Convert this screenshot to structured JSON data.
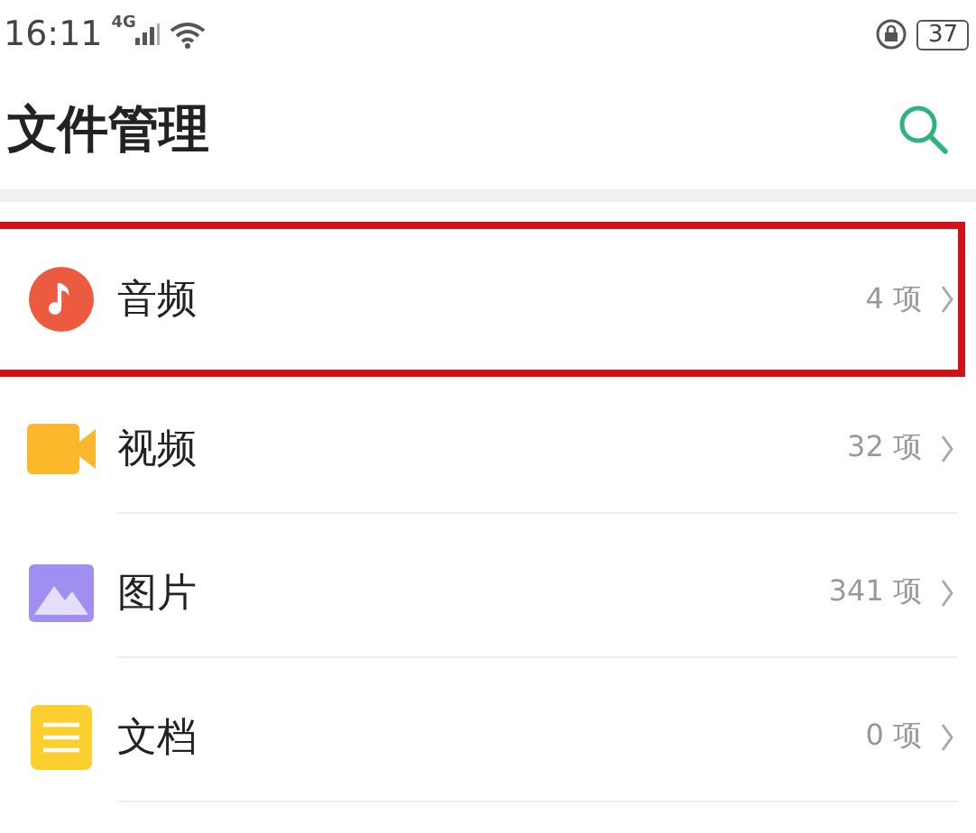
{
  "status_bar": {
    "time": "16:11",
    "network": "4G",
    "battery": "37"
  },
  "header": {
    "title": "文件管理"
  },
  "categories": [
    {
      "kind": "audio",
      "label": "音频",
      "count": "4 项",
      "highlighted": true
    },
    {
      "kind": "video",
      "label": "视频",
      "count": "32 项",
      "highlighted": false
    },
    {
      "kind": "image",
      "label": "图片",
      "count": "341 项",
      "highlighted": false
    },
    {
      "kind": "document",
      "label": "文档",
      "count": "0 项",
      "highlighted": false
    }
  ]
}
